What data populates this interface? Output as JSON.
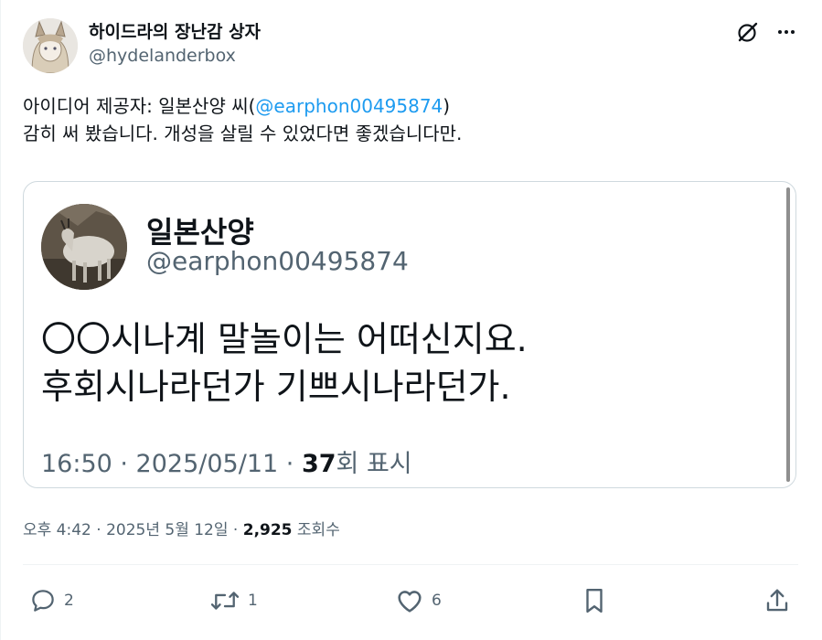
{
  "author": {
    "display_name": "하이드라의 장난감 상자",
    "handle": "@hydelanderbox"
  },
  "tweet": {
    "text_prefix": "아이디어 제공자: 일본산양 씨(",
    "mention": "@earphon00495874",
    "text_suffix": ")",
    "line2": "감히 써 봤습니다. 개성을 살릴 수 있었다면 좋겠습니다만."
  },
  "quoted": {
    "display_name": "일본산양",
    "handle": "@earphon00495874",
    "line1": "〇〇시나계 말놀이는 어떠신지요.",
    "line2": "후회시나라던가 기쁘시나라던가.",
    "meta_prefix": "16:50 · 2025/05/11 · ",
    "views_count": "37",
    "views_label": "회 표시"
  },
  "meta": {
    "time_date": "오후 4:42 · 2025년 5월 12일 · ",
    "views_count": "2,925",
    "views_label": "조회수"
  },
  "actions": {
    "reply_count": "2",
    "retweet_count": "1",
    "like_count": "6"
  },
  "icons": [
    "grok-icon",
    "more-icon",
    "reply-icon",
    "retweet-icon",
    "like-icon",
    "bookmark-icon",
    "share-icon"
  ],
  "colors": {
    "accent": "#1d9bf0",
    "secondary_text": "#536471",
    "border": "#cfd9de"
  }
}
